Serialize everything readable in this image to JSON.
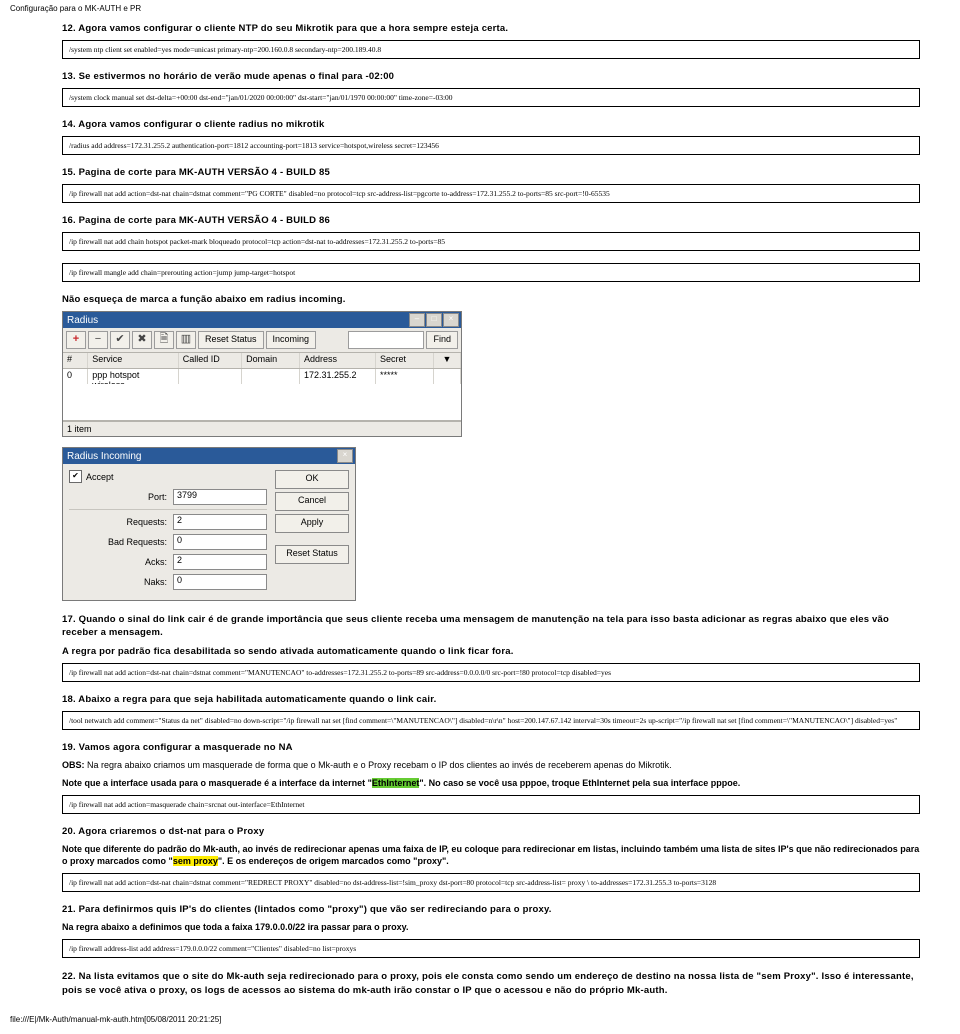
{
  "header": "Configuração para o MK-AUTH e PR",
  "steps": {
    "s12": {
      "title": "12. Agora vamos configurar o cliente NTP do seu Mikrotik para que a hora sempre esteja certa.",
      "cmd": "/system ntp client set enabled=yes mode=unicast primary-ntp=200.160.0.8 secondary-ntp=200.189.40.8"
    },
    "s13": {
      "title": "13. Se estivermos no horário de verão mude apenas o final para -02:00",
      "cmd": "/system clock manual set dst-delta=+00:00 dst-end=\"jan/01/2020 00:00:00\" dst-start=\"jan/01/1970 00:00:00\" time-zone=-03:00"
    },
    "s14": {
      "title": "14. Agora vamos configurar o cliente radius no mikrotik",
      "cmd": "/radius add address=172.31.255.2 authentication-port=1812 accounting-port=1813 service=hotspot,wireless secret=123456"
    },
    "s15": {
      "title": "15. Pagina de corte para MK-AUTH VERSÃO 4 - BUILD 85",
      "cmd": "/ip firewall nat add action=dst-nat chain=dstnat comment=\"PG CORTE\" disabled=no protocol=tcp src-address-list=pgcorte to-address=172.31.255.2 to-ports=85 src-port=!0-65535"
    },
    "s16": {
      "title": "16. Pagina de corte para MK-AUTH VERSÃO 4 - BUILD 86",
      "cmd1": "/ip firewall nat add chain hotspot packet-mark bloqueado protocol=tcp action=dst-nat to-addresses=172.31.255.2 to-ports=85",
      "cmd2": "/ip firewall mangle add chain=prerouting action=jump jump-target=hotspot",
      "note": "Não esqueça de marca a função abaixo em radius incoming."
    },
    "s17": {
      "t1": "17. Quando o sinal do link cair é de grande importância que seus cliente receba uma mensagem de manutenção na tela para isso basta adicionar as regras abaixo que eles vão receber a mensagem.",
      "t2": "A regra por padrão fica desabilitada so sendo ativada automaticamente quando o link ficar fora.",
      "cmd": "/ip firewall nat add action=dst-nat chain=dstnat comment=\"MANUTENCAO\" to-addresses=172.31.255.2 to-ports=89 src-address=0.0.0.0/0 src-port=!80 protocol=tcp disabled=yes"
    },
    "s18": {
      "title": "18. Abaixo a regra para que seja habilitada automaticamente quando o link cair.",
      "cmd": "/tool netwatch add comment=\"Status da net\" disabled=no down-script=\"/ip firewall nat set [find comment=\\\"MANUTENCAO\\\"] disabled=n\\r\\n\" host=200.147.67.142 interval=30s timeout=2s up-script=\"/ip firewall nat set [find comment=\\\"MANUTENCAO\\\"] disabled=yes\""
    },
    "s19": {
      "title": "19. Vamos agora configurar a masquerade no NA",
      "obs_label": "OBS:",
      "obs": " Na regra abaixo criamos um masquerade de forma que o Mk-auth e o Proxy recebam o IP dos clientes ao invés de receberem apenas do Mikrotik.",
      "note_a": "Note que a interface usada para o masquerade é a interface da internet \"",
      "hl": "EthInternet",
      "note_b": "\". No caso se você usa pppoe, troque EthInternet pela sua interface pppoe.",
      "cmd": "/ip firewall nat add action=masquerade chain=srcnat out-interface=EthInternet"
    },
    "s20": {
      "title": "20. Agora criaremos o dst-nat para o Proxy",
      "note_a": "Note que diferente do padrão do Mk-auth, ao invés de redirecionar apenas uma faixa de IP, eu coloque para redirecionar em listas, incluindo também uma lista de sites IP's que não redirecionados para o proxy marcados como \"",
      "hl": "sem proxy",
      "note_b": "\". E os endereços de origem marcados como \"proxy\".",
      "cmd": "/ip firewall nat add action=dst-nat chain=dstnat comment=\"REDRECT PROXY\" disabled=no dst-address-list=!sim_proxy dst-port=80 protocol=tcp src-address-list= proxy \\ to-addresses=172.31.255.3 to-ports=3128"
    },
    "s21": {
      "title": "21. Para definirmos quis IP's do clientes (lintados como \"proxy\") que vão ser redireciando para o proxy.",
      "note": "Na regra abaixo a definimos que toda a faixa 179.0.0.0/22 ira passar para o proxy.",
      "cmd": "/ip firewall address-list add address=179.0.0.0/22 comment=\"Clientes\" disabled=no list=proxys"
    },
    "s22": {
      "title": "22. Na lista evitamos que o site do Mk-auth seja redirecionado para o proxy, pois ele consta como sendo um endereço de destino na nossa lista de \"sem Proxy\". Isso é interessante, pois se você ativa o proxy, os logs de acessos ao sistema do mk-auth irão constar o IP que o acessou e não do próprio Mk-auth."
    }
  },
  "radius_window": {
    "title": "Radius",
    "btn_reset": "Reset Status",
    "btn_incoming": "Incoming",
    "find": "Find",
    "cols": {
      "hash": "#",
      "service": "Service",
      "called": "Called ID",
      "domain": "Domain",
      "address": "Address",
      "secret": "Secret",
      "end": "▼"
    },
    "row": {
      "hash": "0",
      "service": "ppp hotspot wireless",
      "called": "",
      "domain": "",
      "address": "172.31.255.2",
      "secret": "*****"
    },
    "status": "1 item"
  },
  "incoming_window": {
    "title": "Radius Incoming",
    "accept": "Accept",
    "port_label": "Port:",
    "port_val": "3799",
    "req_label": "Requests:",
    "req_val": "2",
    "bad_label": "Bad Requests:",
    "bad_val": "0",
    "acks_label": "Acks:",
    "acks_val": "2",
    "naks_label": "Naks:",
    "naks_val": "0",
    "btn_ok": "OK",
    "btn_cancel": "Cancel",
    "btn_apply": "Apply",
    "btn_reset": "Reset Status"
  },
  "footer": "file:///E|/Mk-Auth/manual-mk-auth.htm[05/08/2011 20:21:25]"
}
